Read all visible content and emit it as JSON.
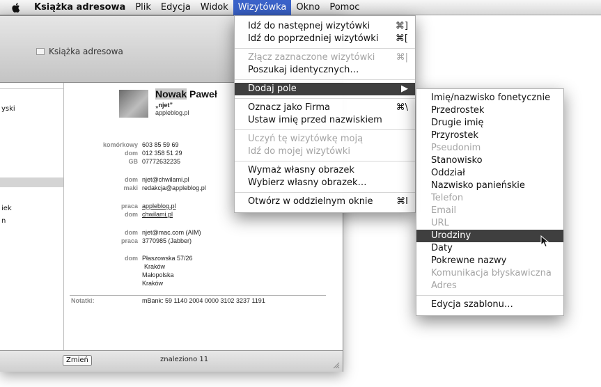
{
  "menubar": {
    "apple_icon": "apple-logo-icon",
    "items": [
      "Książka adresowa",
      "Plik",
      "Edycja",
      "Widok",
      "Wizytówka",
      "Okno",
      "Pomoc"
    ]
  },
  "window": {
    "title": "Książka adresowa",
    "left_fragments": [
      "yski",
      "iek",
      "n"
    ],
    "edit_button": "Zmień",
    "found_text": "znaleziono 11"
  },
  "card": {
    "last_name": "Nowak",
    "first_name": "Paweł",
    "nickname": "„njet”",
    "company": "appleblog.pl",
    "fields": [
      {
        "label": "komórkowy",
        "value": "603 85 59 69"
      },
      {
        "label": "dom",
        "value": "012 358 51 29"
      },
      {
        "label": "GB",
        "value": "07772632235"
      },
      {
        "label": "dom",
        "value": "njet@chwilami.pl"
      },
      {
        "label": "maki",
        "value": "redakcja@appleblog.pl"
      },
      {
        "label": "praca",
        "value": "appleblog.pl"
      },
      {
        "label": "dom",
        "value": "chwilami.pl"
      },
      {
        "label": "dom",
        "value": "njet@mac.com (AIM)"
      },
      {
        "label": "praca",
        "value": "3770985 (Jabber)"
      },
      {
        "label": "dom",
        "value": "Płaszowska 57/26"
      }
    ],
    "address_lines": [
      "Kraków",
      "Małopolska",
      "Kraków"
    ],
    "notes_label": "Notatki:",
    "notes_value": "mBank: 59 1140 2004 0000 3102 3237 1191"
  },
  "menu_main": {
    "items": [
      {
        "label": "Idź do następnej wizytówki",
        "shortcut": "⌘]",
        "disabled": false
      },
      {
        "label": "Idź do poprzedniej wizytówki",
        "shortcut": "⌘[",
        "disabled": false
      },
      {
        "label": "Złącz zaznaczone wizytówki",
        "shortcut": "⌘|",
        "disabled": true
      },
      {
        "label": "Poszukaj identycznych…",
        "shortcut": "",
        "disabled": false
      },
      {
        "label": "Dodaj pole",
        "shortcut": "▶",
        "disabled": false,
        "selected": true
      },
      {
        "label": "Oznacz jako Firma",
        "shortcut": "⌘\\",
        "disabled": false
      },
      {
        "label": "Ustaw imię przed nazwiskiem",
        "shortcut": "",
        "disabled": false
      },
      {
        "label": "Uczyń tę wizytówkę moją",
        "shortcut": "",
        "disabled": true
      },
      {
        "label": "Idź do mojej wizytówki",
        "shortcut": "",
        "disabled": true
      },
      {
        "label": "Wymaż własny obrazek",
        "shortcut": "",
        "disabled": false
      },
      {
        "label": "Wybierz własny obrazek…",
        "shortcut": "",
        "disabled": false
      },
      {
        "label": "Otwórz w oddzielnym oknie",
        "shortcut": "⌘I",
        "disabled": false
      }
    ]
  },
  "menu_sub": {
    "items": [
      {
        "label": "Imię/nazwisko fonetycznie",
        "disabled": false
      },
      {
        "label": "Przedrostek",
        "disabled": false
      },
      {
        "label": "Drugie imię",
        "disabled": false
      },
      {
        "label": "Przyrostek",
        "disabled": false
      },
      {
        "label": "Pseudonim",
        "disabled": true
      },
      {
        "label": "Stanowisko",
        "disabled": false
      },
      {
        "label": "Oddział",
        "disabled": false
      },
      {
        "label": "Nazwisko panieńskie",
        "disabled": false
      },
      {
        "label": "Telefon",
        "disabled": true
      },
      {
        "label": "Email",
        "disabled": true
      },
      {
        "label": "URL",
        "disabled": true
      },
      {
        "label": "Urodziny",
        "disabled": false,
        "selected": true
      },
      {
        "label": "Daty",
        "disabled": false
      },
      {
        "label": "Pokrewne nazwy",
        "disabled": false
      },
      {
        "label": "Komunikacja błyskawiczna",
        "disabled": true
      },
      {
        "label": "Adres",
        "disabled": true
      },
      {
        "label": "Edycja szablonu…",
        "disabled": false
      }
    ]
  },
  "colors": {
    "menu_highlight": "#3a62c9",
    "menu_selected": "#3f3f3f",
    "disabled_text": "#a4a4a4"
  }
}
